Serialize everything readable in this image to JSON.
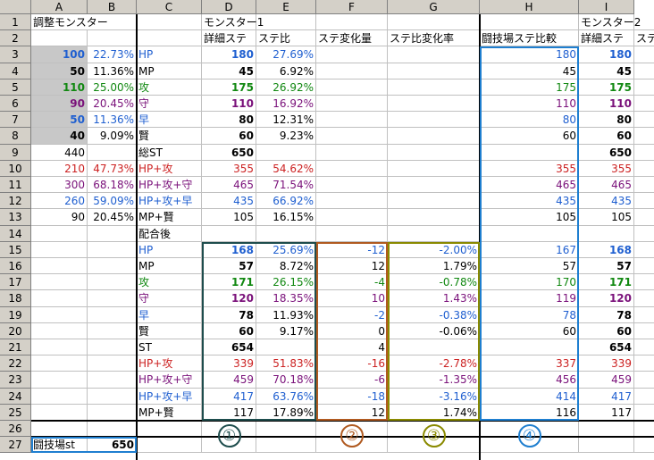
{
  "columns": [
    "A",
    "B",
    "C",
    "D",
    "E",
    "F",
    "G",
    "H",
    "I"
  ],
  "rows": [
    "1",
    "2",
    "3",
    "4",
    "5",
    "6",
    "7",
    "8",
    "9",
    "10",
    "11",
    "12",
    "13",
    "14",
    "15",
    "16",
    "17",
    "18",
    "19",
    "20",
    "21",
    "22",
    "23",
    "24",
    "25",
    "26",
    "27"
  ],
  "cells": [
    {
      "c": 0,
      "r": 0,
      "t": "調整モンスター",
      "span": 2
    },
    {
      "c": 3,
      "r": 0,
      "t": "モンスター1"
    },
    {
      "c": 8,
      "r": 0,
      "t": "モンスター2"
    },
    {
      "c": 3,
      "r": 1,
      "t": "詳細ステ"
    },
    {
      "c": 4,
      "r": 1,
      "t": "ステ比"
    },
    {
      "c": 5,
      "r": 1,
      "t": "ステ変化量"
    },
    {
      "c": 6,
      "r": 1,
      "t": "ステ比変化率"
    },
    {
      "c": 7,
      "r": 1,
      "t": "闘技場ステ比較"
    },
    {
      "c": 8,
      "r": 1,
      "t": "詳細ステ"
    },
    {
      "c": 9,
      "r": 1,
      "t": "ステ"
    },
    {
      "c": 0,
      "r": 2,
      "t": "100",
      "cl": "r b blue shade"
    },
    {
      "c": 1,
      "r": 2,
      "t": "22.73%",
      "cl": "r blue"
    },
    {
      "c": 2,
      "r": 2,
      "t": "HP",
      "cl": "blue"
    },
    {
      "c": 3,
      "r": 2,
      "t": "180",
      "cl": "r b blue"
    },
    {
      "c": 4,
      "r": 2,
      "t": "27.69%",
      "cl": "r blue"
    },
    {
      "c": 7,
      "r": 2,
      "t": "180",
      "cl": "r blue"
    },
    {
      "c": 8,
      "r": 2,
      "t": "180",
      "cl": "r b blue"
    },
    {
      "c": 0,
      "r": 3,
      "t": "50",
      "cl": "r b shade"
    },
    {
      "c": 1,
      "r": 3,
      "t": "11.36%",
      "cl": "r"
    },
    {
      "c": 2,
      "r": 3,
      "t": "MP"
    },
    {
      "c": 3,
      "r": 3,
      "t": "45",
      "cl": "r b"
    },
    {
      "c": 4,
      "r": 3,
      "t": "6.92%",
      "cl": "r"
    },
    {
      "c": 7,
      "r": 3,
      "t": "45",
      "cl": "r"
    },
    {
      "c": 8,
      "r": 3,
      "t": "45",
      "cl": "r b"
    },
    {
      "c": 0,
      "r": 4,
      "t": "110",
      "cl": "r b green shade"
    },
    {
      "c": 1,
      "r": 4,
      "t": "25.00%",
      "cl": "r green"
    },
    {
      "c": 2,
      "r": 4,
      "t": "攻",
      "cl": "green"
    },
    {
      "c": 3,
      "r": 4,
      "t": "175",
      "cl": "r b green"
    },
    {
      "c": 4,
      "r": 4,
      "t": "26.92%",
      "cl": "r green"
    },
    {
      "c": 7,
      "r": 4,
      "t": "175",
      "cl": "r green"
    },
    {
      "c": 8,
      "r": 4,
      "t": "175",
      "cl": "r b green"
    },
    {
      "c": 0,
      "r": 5,
      "t": "90",
      "cl": "r b purple shade"
    },
    {
      "c": 1,
      "r": 5,
      "t": "20.45%",
      "cl": "r purple"
    },
    {
      "c": 2,
      "r": 5,
      "t": "守",
      "cl": "purple"
    },
    {
      "c": 3,
      "r": 5,
      "t": "110",
      "cl": "r b purple"
    },
    {
      "c": 4,
      "r": 5,
      "t": "16.92%",
      "cl": "r purple"
    },
    {
      "c": 7,
      "r": 5,
      "t": "110",
      "cl": "r purple"
    },
    {
      "c": 8,
      "r": 5,
      "t": "110",
      "cl": "r b purple"
    },
    {
      "c": 0,
      "r": 6,
      "t": "50",
      "cl": "r b blue shade"
    },
    {
      "c": 1,
      "r": 6,
      "t": "11.36%",
      "cl": "r blue"
    },
    {
      "c": 2,
      "r": 6,
      "t": "早",
      "cl": "blue"
    },
    {
      "c": 3,
      "r": 6,
      "t": "80",
      "cl": "r b"
    },
    {
      "c": 4,
      "r": 6,
      "t": "12.31%",
      "cl": "r"
    },
    {
      "c": 7,
      "r": 6,
      "t": "80",
      "cl": "r blue"
    },
    {
      "c": 8,
      "r": 6,
      "t": "80",
      "cl": "r b"
    },
    {
      "c": 0,
      "r": 7,
      "t": "40",
      "cl": "r b shade"
    },
    {
      "c": 1,
      "r": 7,
      "t": "9.09%",
      "cl": "r"
    },
    {
      "c": 2,
      "r": 7,
      "t": "賢"
    },
    {
      "c": 3,
      "r": 7,
      "t": "60",
      "cl": "r b"
    },
    {
      "c": 4,
      "r": 7,
      "t": "9.23%",
      "cl": "r"
    },
    {
      "c": 7,
      "r": 7,
      "t": "60",
      "cl": "r"
    },
    {
      "c": 8,
      "r": 7,
      "t": "60",
      "cl": "r b"
    },
    {
      "c": 0,
      "r": 8,
      "t": "440",
      "cl": "r"
    },
    {
      "c": 2,
      "r": 8,
      "t": "総ST"
    },
    {
      "c": 3,
      "r": 8,
      "t": "650",
      "cl": "r b"
    },
    {
      "c": 8,
      "r": 8,
      "t": "650",
      "cl": "r b"
    },
    {
      "c": 0,
      "r": 9,
      "t": "210",
      "cl": "r red"
    },
    {
      "c": 1,
      "r": 9,
      "t": "47.73%",
      "cl": "r red"
    },
    {
      "c": 2,
      "r": 9,
      "t": "HP+攻",
      "cl": "red"
    },
    {
      "c": 3,
      "r": 9,
      "t": "355",
      "cl": "r red"
    },
    {
      "c": 4,
      "r": 9,
      "t": "54.62%",
      "cl": "r red"
    },
    {
      "c": 7,
      "r": 9,
      "t": "355",
      "cl": "r red"
    },
    {
      "c": 8,
      "r": 9,
      "t": "355",
      "cl": "r red"
    },
    {
      "c": 0,
      "r": 10,
      "t": "300",
      "cl": "r purple"
    },
    {
      "c": 1,
      "r": 10,
      "t": "68.18%",
      "cl": "r purple"
    },
    {
      "c": 2,
      "r": 10,
      "t": "HP+攻+守",
      "cl": "purple"
    },
    {
      "c": 3,
      "r": 10,
      "t": "465",
      "cl": "r purple"
    },
    {
      "c": 4,
      "r": 10,
      "t": "71.54%",
      "cl": "r purple"
    },
    {
      "c": 7,
      "r": 10,
      "t": "465",
      "cl": "r purple"
    },
    {
      "c": 8,
      "r": 10,
      "t": "465",
      "cl": "r purple"
    },
    {
      "c": 0,
      "r": 11,
      "t": "260",
      "cl": "r blue"
    },
    {
      "c": 1,
      "r": 11,
      "t": "59.09%",
      "cl": "r blue"
    },
    {
      "c": 2,
      "r": 11,
      "t": "HP+攻+早",
      "cl": "blue"
    },
    {
      "c": 3,
      "r": 11,
      "t": "435",
      "cl": "r blue"
    },
    {
      "c": 4,
      "r": 11,
      "t": "66.92%",
      "cl": "r blue"
    },
    {
      "c": 7,
      "r": 11,
      "t": "435",
      "cl": "r blue"
    },
    {
      "c": 8,
      "r": 11,
      "t": "435",
      "cl": "r blue"
    },
    {
      "c": 0,
      "r": 12,
      "t": "90",
      "cl": "r"
    },
    {
      "c": 1,
      "r": 12,
      "t": "20.45%",
      "cl": "r"
    },
    {
      "c": 2,
      "r": 12,
      "t": "MP+賢"
    },
    {
      "c": 3,
      "r": 12,
      "t": "105",
      "cl": "r"
    },
    {
      "c": 4,
      "r": 12,
      "t": "16.15%",
      "cl": "r"
    },
    {
      "c": 7,
      "r": 12,
      "t": "105",
      "cl": "r"
    },
    {
      "c": 8,
      "r": 12,
      "t": "105",
      "cl": "r"
    },
    {
      "c": 2,
      "r": 13,
      "t": "配合後"
    },
    {
      "c": 2,
      "r": 14,
      "t": "HP",
      "cl": "blue"
    },
    {
      "c": 3,
      "r": 14,
      "t": "168",
      "cl": "r b blue"
    },
    {
      "c": 4,
      "r": 14,
      "t": "25.69%",
      "cl": "r blue"
    },
    {
      "c": 5,
      "r": 14,
      "t": "-12",
      "cl": "r blue"
    },
    {
      "c": 6,
      "r": 14,
      "t": "-2.00%",
      "cl": "r blue"
    },
    {
      "c": 7,
      "r": 14,
      "t": "167",
      "cl": "r blue"
    },
    {
      "c": 8,
      "r": 14,
      "t": "168",
      "cl": "r b blue"
    },
    {
      "c": 2,
      "r": 15,
      "t": "MP"
    },
    {
      "c": 3,
      "r": 15,
      "t": "57",
      "cl": "r b"
    },
    {
      "c": 4,
      "r": 15,
      "t": "8.72%",
      "cl": "r"
    },
    {
      "c": 5,
      "r": 15,
      "t": "12",
      "cl": "r"
    },
    {
      "c": 6,
      "r": 15,
      "t": "1.79%",
      "cl": "r"
    },
    {
      "c": 7,
      "r": 15,
      "t": "57",
      "cl": "r"
    },
    {
      "c": 8,
      "r": 15,
      "t": "57",
      "cl": "r b"
    },
    {
      "c": 2,
      "r": 16,
      "t": "攻",
      "cl": "green"
    },
    {
      "c": 3,
      "r": 16,
      "t": "171",
      "cl": "r b green"
    },
    {
      "c": 4,
      "r": 16,
      "t": "26.15%",
      "cl": "r green"
    },
    {
      "c": 5,
      "r": 16,
      "t": "-4",
      "cl": "r green"
    },
    {
      "c": 6,
      "r": 16,
      "t": "-0.78%",
      "cl": "r green"
    },
    {
      "c": 7,
      "r": 16,
      "t": "170",
      "cl": "r green"
    },
    {
      "c": 8,
      "r": 16,
      "t": "171",
      "cl": "r b green"
    },
    {
      "c": 2,
      "r": 17,
      "t": "守",
      "cl": "purple"
    },
    {
      "c": 3,
      "r": 17,
      "t": "120",
      "cl": "r b purple"
    },
    {
      "c": 4,
      "r": 17,
      "t": "18.35%",
      "cl": "r purple"
    },
    {
      "c": 5,
      "r": 17,
      "t": "10",
      "cl": "r purple"
    },
    {
      "c": 6,
      "r": 17,
      "t": "1.43%",
      "cl": "r purple"
    },
    {
      "c": 7,
      "r": 17,
      "t": "119",
      "cl": "r purple"
    },
    {
      "c": 8,
      "r": 17,
      "t": "120",
      "cl": "r b purple"
    },
    {
      "c": 2,
      "r": 18,
      "t": "早",
      "cl": "blue"
    },
    {
      "c": 3,
      "r": 18,
      "t": "78",
      "cl": "r b"
    },
    {
      "c": 4,
      "r": 18,
      "t": "11.93%",
      "cl": "r"
    },
    {
      "c": 5,
      "r": 18,
      "t": "-2",
      "cl": "r blue"
    },
    {
      "c": 6,
      "r": 18,
      "t": "-0.38%",
      "cl": "r blue"
    },
    {
      "c": 7,
      "r": 18,
      "t": "78",
      "cl": "r blue"
    },
    {
      "c": 8,
      "r": 18,
      "t": "78",
      "cl": "r b"
    },
    {
      "c": 2,
      "r": 19,
      "t": "賢"
    },
    {
      "c": 3,
      "r": 19,
      "t": "60",
      "cl": "r b"
    },
    {
      "c": 4,
      "r": 19,
      "t": "9.17%",
      "cl": "r"
    },
    {
      "c": 5,
      "r": 19,
      "t": "0",
      "cl": "r"
    },
    {
      "c": 6,
      "r": 19,
      "t": "-0.06%",
      "cl": "r"
    },
    {
      "c": 7,
      "r": 19,
      "t": "60",
      "cl": "r"
    },
    {
      "c": 8,
      "r": 19,
      "t": "60",
      "cl": "r b"
    },
    {
      "c": 2,
      "r": 20,
      "t": "ST"
    },
    {
      "c": 3,
      "r": 20,
      "t": "654",
      "cl": "r b"
    },
    {
      "c": 5,
      "r": 20,
      "t": "4",
      "cl": "r"
    },
    {
      "c": 8,
      "r": 20,
      "t": "654",
      "cl": "r b"
    },
    {
      "c": 2,
      "r": 21,
      "t": "HP+攻",
      "cl": "red"
    },
    {
      "c": 3,
      "r": 21,
      "t": "339",
      "cl": "r red"
    },
    {
      "c": 4,
      "r": 21,
      "t": "51.83%",
      "cl": "r red"
    },
    {
      "c": 5,
      "r": 21,
      "t": "-16",
      "cl": "r red"
    },
    {
      "c": 6,
      "r": 21,
      "t": "-2.78%",
      "cl": "r red"
    },
    {
      "c": 7,
      "r": 21,
      "t": "337",
      "cl": "r red"
    },
    {
      "c": 8,
      "r": 21,
      "t": "339",
      "cl": "r red"
    },
    {
      "c": 2,
      "r": 22,
      "t": "HP+攻+守",
      "cl": "purple"
    },
    {
      "c": 3,
      "r": 22,
      "t": "459",
      "cl": "r purple"
    },
    {
      "c": 4,
      "r": 22,
      "t": "70.18%",
      "cl": "r purple"
    },
    {
      "c": 5,
      "r": 22,
      "t": "-6",
      "cl": "r purple"
    },
    {
      "c": 6,
      "r": 22,
      "t": "-1.35%",
      "cl": "r purple"
    },
    {
      "c": 7,
      "r": 22,
      "t": "456",
      "cl": "r purple"
    },
    {
      "c": 8,
      "r": 22,
      "t": "459",
      "cl": "r purple"
    },
    {
      "c": 2,
      "r": 23,
      "t": "HP+攻+早",
      "cl": "blue"
    },
    {
      "c": 3,
      "r": 23,
      "t": "417",
      "cl": "r blue"
    },
    {
      "c": 4,
      "r": 23,
      "t": "63.76%",
      "cl": "r blue"
    },
    {
      "c": 5,
      "r": 23,
      "t": "-18",
      "cl": "r blue"
    },
    {
      "c": 6,
      "r": 23,
      "t": "-3.16%",
      "cl": "r blue"
    },
    {
      "c": 7,
      "r": 23,
      "t": "414",
      "cl": "r blue"
    },
    {
      "c": 8,
      "r": 23,
      "t": "417",
      "cl": "r blue"
    },
    {
      "c": 2,
      "r": 24,
      "t": "MP+賢"
    },
    {
      "c": 3,
      "r": 24,
      "t": "117",
      "cl": "r"
    },
    {
      "c": 4,
      "r": 24,
      "t": "17.89%",
      "cl": "r"
    },
    {
      "c": 5,
      "r": 24,
      "t": "12",
      "cl": "r"
    },
    {
      "c": 6,
      "r": 24,
      "t": "1.74%",
      "cl": "r"
    },
    {
      "c": 7,
      "r": 24,
      "t": "116",
      "cl": "r"
    },
    {
      "c": 8,
      "r": 24,
      "t": "117",
      "cl": "r"
    },
    {
      "c": 0,
      "r": 26,
      "t": "闘技場st"
    },
    {
      "c": 1,
      "r": 26,
      "t": "650",
      "cl": "r b"
    }
  ],
  "circles": [
    {
      "col": 3,
      "label": "①",
      "color": "#1e4d4d"
    },
    {
      "col": 5,
      "label": "②",
      "color": "#b05a20"
    },
    {
      "col": 6,
      "label": "③",
      "color": "#8a8a00"
    },
    {
      "col": 7,
      "label": "④",
      "color": "#1f7fd0"
    }
  ]
}
